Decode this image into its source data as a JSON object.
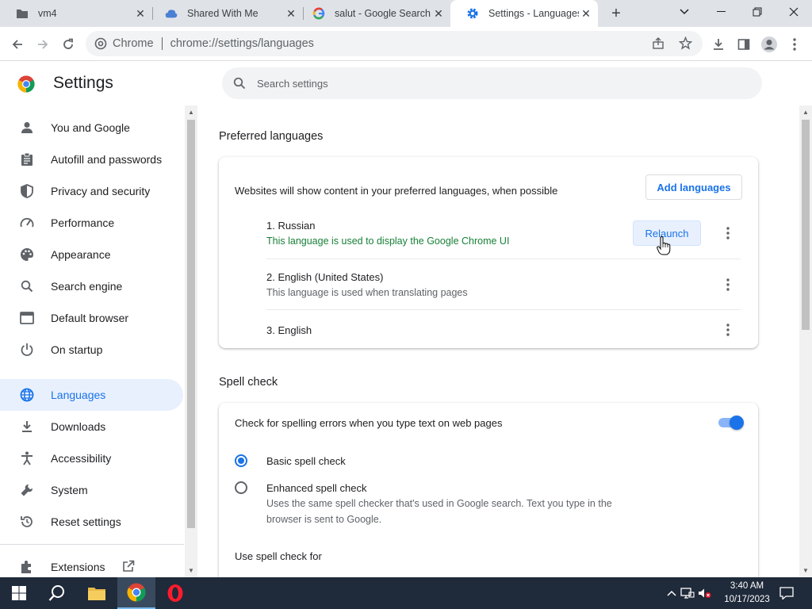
{
  "tabs": [
    {
      "label": "vm4",
      "icon": "folder-icon"
    },
    {
      "label": "Shared With Me",
      "icon": "drive-icon"
    },
    {
      "label": "salut - Google Search",
      "icon": "google-icon"
    },
    {
      "label": "Settings - Languages",
      "icon": "gear-icon",
      "active": true
    }
  ],
  "omnibox": {
    "site": "Chrome",
    "url": "chrome://settings/languages"
  },
  "settings": {
    "title": "Settings",
    "search_placeholder": "Search settings"
  },
  "sidebar": {
    "items": [
      {
        "label": "You and Google",
        "icon": "person-icon"
      },
      {
        "label": "Autofill and passwords",
        "icon": "clipboard-icon"
      },
      {
        "label": "Privacy and security",
        "icon": "shield-icon"
      },
      {
        "label": "Performance",
        "icon": "gauge-icon"
      },
      {
        "label": "Appearance",
        "icon": "palette-icon"
      },
      {
        "label": "Search engine",
        "icon": "search-icon"
      },
      {
        "label": "Default browser",
        "icon": "browser-icon"
      },
      {
        "label": "On startup",
        "icon": "power-icon"
      },
      {
        "label": "Languages",
        "icon": "globe-icon",
        "active": true
      },
      {
        "label": "Downloads",
        "icon": "download-icon"
      },
      {
        "label": "Accessibility",
        "icon": "accessibility-icon"
      },
      {
        "label": "System",
        "icon": "wrench-icon"
      },
      {
        "label": "Reset settings",
        "icon": "reset-icon"
      }
    ],
    "extensions_label": "Extensions"
  },
  "preferred": {
    "title": "Preferred languages",
    "description": "Websites will show content in your preferred languages, when possible",
    "add_button": "Add languages",
    "languages": [
      {
        "name": "1. Russian",
        "note": "This language is used to display the Google Chrome UI"
      },
      {
        "name": "2. English (United States)",
        "note": "This language is used when translating pages"
      },
      {
        "name": "3. English",
        "note": ""
      }
    ],
    "relaunch_button": "Relaunch"
  },
  "spell": {
    "title": "Spell check",
    "toggle_label": "Check for spelling errors when you type text on web pages",
    "toggle_on": true,
    "basic_label": "Basic spell check",
    "enhanced_label": "Enhanced spell check",
    "enhanced_desc_1": "Uses the same spell checker that's used in Google search. Text you type in the",
    "enhanced_desc_2": "browser is sent to Google.",
    "use_for_label": "Use spell check for"
  },
  "taskbar": {
    "time": "3:40 AM",
    "date": "10/17/2023"
  },
  "colors": {
    "accent": "#1a73e8",
    "green_note": "#188038",
    "taskbar": "#1f2a3a"
  }
}
